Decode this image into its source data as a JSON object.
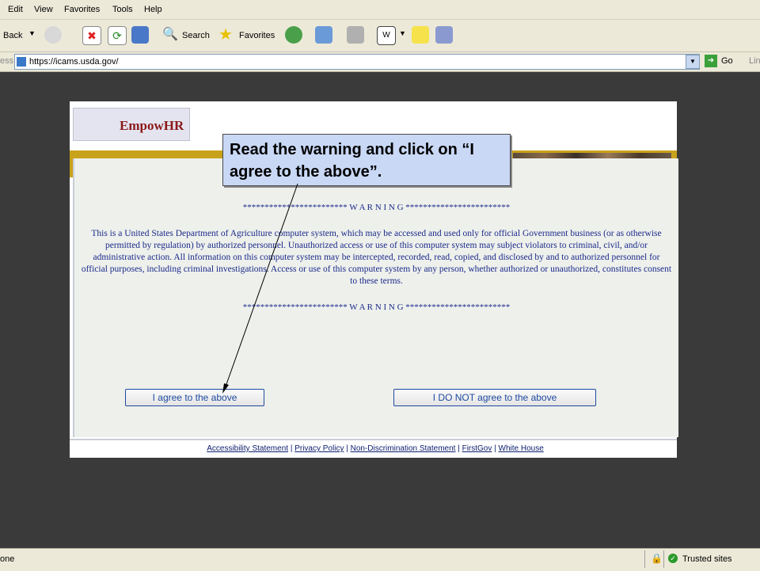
{
  "menu": [
    "Edit",
    "View",
    "Favorites",
    "Tools",
    "Help"
  ],
  "toolbar": {
    "back_label": "Back",
    "search_label": "Search",
    "favorites_label": "Favorites"
  },
  "address": {
    "prefix": "ess",
    "url": "https://icams.usda.gov/",
    "go_label": "Go",
    "links_label": "Lin"
  },
  "logo": {
    "text": "EmpowHR"
  },
  "warning": {
    "header": "************************ W A R N I N G ************************",
    "body": "This is a United States Department of Agriculture computer system, which may be accessed and used only for official Government business (or as otherwise permitted by regulation) by authorized personnel. Unauthorized access or use of this computer system may subject violators to criminal, civil, and/or administrative action. All information on this computer system may be intercepted, recorded, read, copied, and disclosed by and to authorized personnel for official purposes, including criminal investigations. Access or use of this computer system by any person, whether authorized or unauthorized, constitutes consent to these terms.",
    "footer": "************************ W A R N I N G ************************"
  },
  "buttons": {
    "agree": "I agree to the above",
    "disagree": "I DO NOT agree to the above"
  },
  "footer_links": [
    "Accessibility Statement",
    "Privacy Policy",
    "Non-Discrimination Statement",
    "FirstGov",
    "White House"
  ],
  "callout": {
    "text": "Read the warning and click on “I agree to the above”."
  },
  "status": {
    "left": "one",
    "right": "Trusted sites"
  },
  "colors": {
    "banner": "#c9a21c",
    "warning_text": "#1a2a8a",
    "callout_bg": "#c9d8f5"
  }
}
